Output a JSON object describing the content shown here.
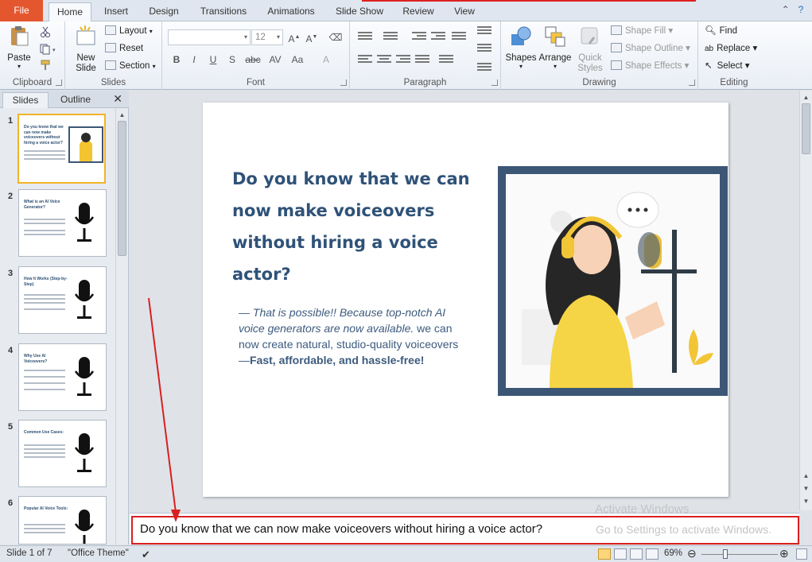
{
  "tabs": [
    "File",
    "Home",
    "Insert",
    "Design",
    "Transitions",
    "Animations",
    "Slide Show",
    "Review",
    "View"
  ],
  "ribbon": {
    "clipboard": {
      "paste": "Paste",
      "label": "Clipboard"
    },
    "slides": {
      "new_slide": "New Slide",
      "layout": "Layout",
      "reset": "Reset",
      "section": "Section",
      "label": "Slides"
    },
    "font": {
      "size": "12",
      "label": "Font",
      "b": "B",
      "i": "I",
      "u": "U",
      "s": "S",
      "abc": "abc",
      "av": "AV",
      "aa": "Aa"
    },
    "paragraph": {
      "label": "Paragraph"
    },
    "drawing": {
      "shapes": "Shapes",
      "arrange": "Arrange",
      "quick_styles": "Quick Styles",
      "shape_fill": "Shape Fill",
      "shape_outline": "Shape Outline",
      "shape_effects": "Shape Effects",
      "label": "Drawing"
    },
    "editing": {
      "find": "Find",
      "replace": "Replace",
      "select": "Select",
      "label": "Editing"
    }
  },
  "panel": {
    "tabs": [
      "Slides",
      "Outline"
    ],
    "thumbs": [
      {
        "num": "1",
        "title": "Do you know that we can now make voiceovers without hiring a voice actor?"
      },
      {
        "num": "2",
        "title": "What is an AI Voice Generator?"
      },
      {
        "num": "3",
        "title": "How It Works (Step-by-Step)"
      },
      {
        "num": "4",
        "title": "Why Use AI Voiceovers?"
      },
      {
        "num": "5",
        "title": "Common Use Cases:"
      },
      {
        "num": "6",
        "title": "Popular AI Voice Tools:"
      }
    ]
  },
  "slide": {
    "title": "Do you know that we can now make voiceovers without hiring a voice actor?",
    "body_italic": "— That is possible!! Because top-notch AI voice generators are now available.",
    "body_regular": " we can now create natural, studio-quality voiceovers—",
    "body_bold": "Fast, affordable, and hassle-free!"
  },
  "notes": {
    "text": "Do you know that we can now make voiceovers without hiring a voice actor?",
    "watermark1": "Activate Windows",
    "watermark2": "Go to Settings to activate Windows."
  },
  "status": {
    "slide": "Slide 1 of 7",
    "theme": "\"Office Theme\"",
    "zoom": "69%"
  },
  "colors": {
    "title": "#2f5278",
    "file_tab": "#e4572e",
    "annotation": "#d92020",
    "frame": "#3c5676"
  }
}
